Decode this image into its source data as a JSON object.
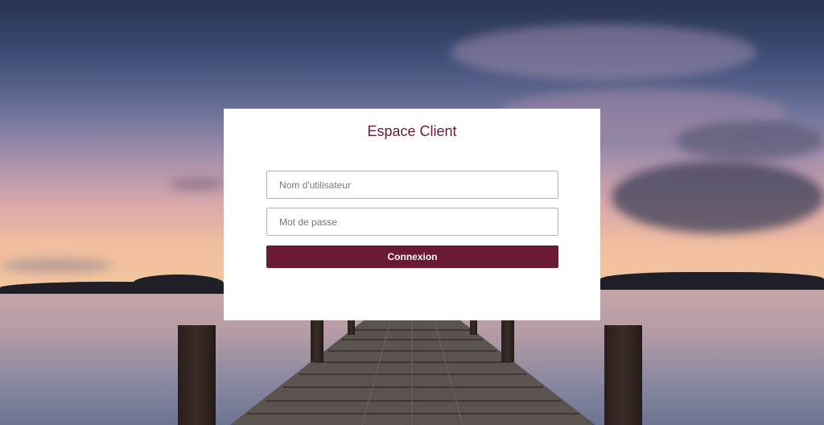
{
  "login": {
    "title": "Espace Client",
    "username_placeholder": "Nom d'utilisateur",
    "password_placeholder": "Mot de passe",
    "submit_label": "Connexion"
  },
  "colors": {
    "accent": "#6a1b33",
    "card_background": "#ffffff"
  }
}
